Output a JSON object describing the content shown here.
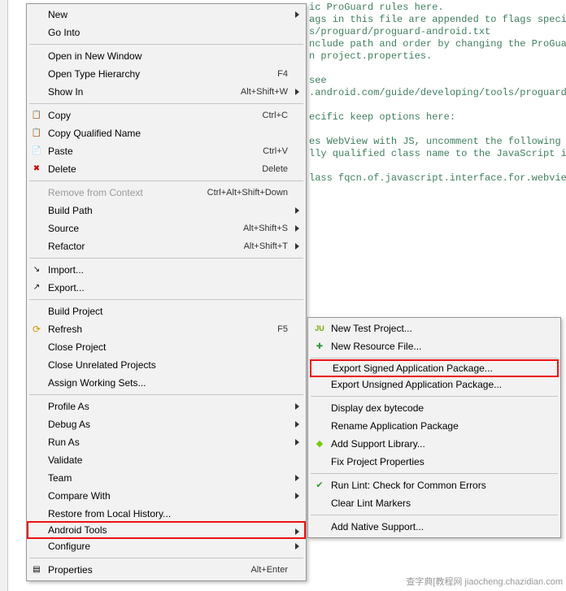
{
  "editor_text": "ic ProGuard rules here.\nags in this file are appended to flags specif\ns/proguard/proguard-android.txt\nnclude path and order by changing the ProGuar\nn project.properties.\n\nsee\n.android.com/guide/developing/tools/proguard.\n\necific keep options here:\n\nes WebView with JS, uncomment the following\nlly qualified class name to the JavaScript in\n\nlass fqcn.of.javascript.interface.for.webview",
  "menu": [
    {
      "label": "New",
      "submenu": true
    },
    {
      "label": "Go Into"
    },
    {
      "sep": true
    },
    {
      "label": "Open in New Window"
    },
    {
      "label": "Open Type Hierarchy",
      "accel": "F4"
    },
    {
      "label": "Show In",
      "accel": "Alt+Shift+W",
      "submenu": true
    },
    {
      "sep": true
    },
    {
      "label": "Copy",
      "accel": "Ctrl+C",
      "icon": "ic-copy"
    },
    {
      "label": "Copy Qualified Name",
      "icon": "ic-copy"
    },
    {
      "label": "Paste",
      "accel": "Ctrl+V",
      "icon": "ic-paste"
    },
    {
      "label": "Delete",
      "accel": "Delete",
      "icon": "ic-del"
    },
    {
      "sep": true
    },
    {
      "label": "Remove from Context",
      "accel": "Ctrl+Alt+Shift+Down",
      "disabled": true
    },
    {
      "label": "Build Path",
      "submenu": true
    },
    {
      "label": "Source",
      "accel": "Alt+Shift+S",
      "submenu": true
    },
    {
      "label": "Refactor",
      "accel": "Alt+Shift+T",
      "submenu": true
    },
    {
      "sep": true
    },
    {
      "label": "Import...",
      "icon": "ic-import"
    },
    {
      "label": "Export...",
      "icon": "ic-export"
    },
    {
      "sep": true
    },
    {
      "label": "Build Project"
    },
    {
      "label": "Refresh",
      "accel": "F5",
      "icon": "ic-refresh"
    },
    {
      "label": "Close Project"
    },
    {
      "label": "Close Unrelated Projects"
    },
    {
      "label": "Assign Working Sets..."
    },
    {
      "sep": true
    },
    {
      "label": "Profile As",
      "submenu": true
    },
    {
      "label": "Debug As",
      "submenu": true
    },
    {
      "label": "Run As",
      "submenu": true
    },
    {
      "label": "Validate"
    },
    {
      "label": "Team",
      "submenu": true
    },
    {
      "label": "Compare With",
      "submenu": true
    },
    {
      "label": "Restore from Local History..."
    },
    {
      "label": "Android Tools",
      "submenu": true,
      "highlight": true
    },
    {
      "label": "Configure",
      "submenu": true
    },
    {
      "sep": true
    },
    {
      "label": "Properties",
      "accel": "Alt+Enter",
      "icon": "ic-props"
    }
  ],
  "submenu": [
    {
      "label": "New Test Project...",
      "icon": "ic-ju"
    },
    {
      "label": "New Resource File...",
      "icon": "ic-newfile"
    },
    {
      "sep": true
    },
    {
      "label": "Export Signed Application Package...",
      "highlight": true
    },
    {
      "label": "Export Unsigned Application Package..."
    },
    {
      "sep": true
    },
    {
      "label": "Display dex bytecode"
    },
    {
      "label": "Rename Application Package"
    },
    {
      "label": "Add Support Library...",
      "icon": "ic-android"
    },
    {
      "label": "Fix Project Properties"
    },
    {
      "sep": true
    },
    {
      "label": "Run Lint: Check for Common Errors",
      "icon": "ic-check"
    },
    {
      "label": "Clear Lint Markers"
    },
    {
      "sep": true
    },
    {
      "label": "Add Native Support..."
    }
  ],
  "watermark": "查字典[教程网\njiaocheng.chazidian.com"
}
